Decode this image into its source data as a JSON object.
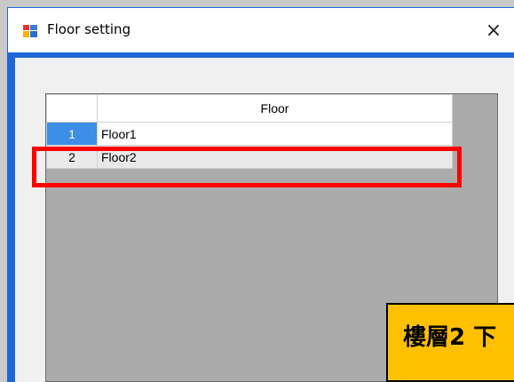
{
  "window": {
    "title": "Floor setting",
    "close_glyph": "×"
  },
  "grid": {
    "column_header": "Floor",
    "rows": [
      {
        "number": "1",
        "floor": "Floor1"
      },
      {
        "number": "2",
        "floor": "Floor2"
      }
    ]
  },
  "annotation": {
    "callout_text": "樓層2 下"
  },
  "colors": {
    "title_bar_border": "#1f66d6",
    "selected_row_header": "#3c8ee6",
    "highlight_box": "#ff0000",
    "callout_fill": "#ffc000"
  }
}
